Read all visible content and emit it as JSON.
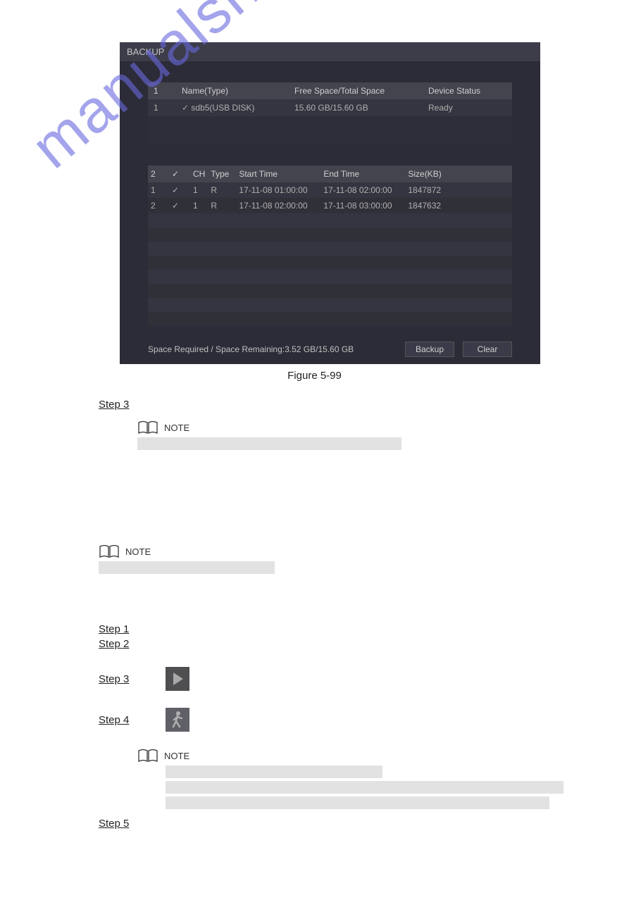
{
  "backup": {
    "title": "BACKUP",
    "device_table": {
      "headers": {
        "idx": "1",
        "name": "Name(Type)",
        "space": "Free Space/Total Space",
        "status": "Device Status"
      },
      "rows": [
        {
          "idx": "1",
          "check": "✓",
          "name": "sdb5(USB DISK)",
          "space": "15.60 GB/15.60 GB",
          "status": "Ready"
        }
      ]
    },
    "file_table": {
      "headers": {
        "count": "2",
        "check": "✓",
        "ch": "CH",
        "type": "Type",
        "start": "Start Time",
        "end": "End Time",
        "size": "Size(KB)"
      },
      "rows": [
        {
          "idx": "1",
          "check": "✓",
          "ch": "1",
          "type": "R",
          "start": "17-11-08 01:00:00",
          "end": "17-11-08 02:00:00",
          "size": "1847872"
        },
        {
          "idx": "2",
          "check": "✓",
          "ch": "1",
          "type": "R",
          "start": "17-11-08 02:00:00",
          "end": "17-11-08 03:00:00",
          "size": "1847632"
        }
      ]
    },
    "footer": {
      "space": "Space Required / Space Remaining:3.52 GB/15.60 GB",
      "backup_btn": "Backup",
      "clear_btn": "Clear"
    }
  },
  "figure_caption": "Figure 5-99",
  "steps": {
    "step3": "Step 3",
    "step1": "Step 1",
    "step2": "Step 2",
    "step3b": "Step 3",
    "step4": "Step 4",
    "step5": "Step 5"
  },
  "note_label": "NOTE",
  "watermark": "manualshive.com"
}
